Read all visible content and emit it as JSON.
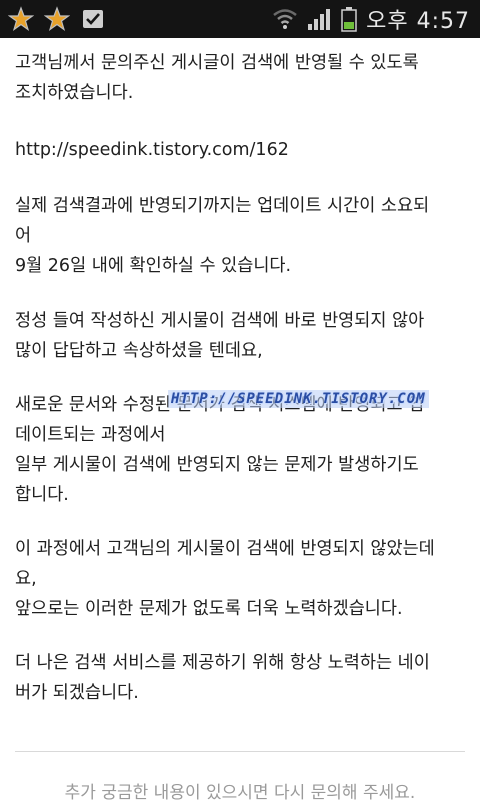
{
  "status_bar": {
    "icons_left": [
      "star-icon",
      "star-icon",
      "checkbox-icon"
    ],
    "icons_right": [
      "wifi-icon",
      "signal-icon",
      "battery-icon"
    ],
    "time": "오후 4:57",
    "colors": {
      "background": "#141414",
      "star": "#e8a22b",
      "icon": "#cfcfcf"
    }
  },
  "message": {
    "p1": [
      "고객님께서 문의주신 게시글이 검색에 반영될 수 있도록",
      "조치하였습니다."
    ],
    "url": "http://speedink.tistory.com/162",
    "p3": [
      "실제 검색결과에 반영되기까지는 업데이트 시간이 소요되",
      "어",
      "9월 26일 내에 확인하실 수 있습니다."
    ],
    "p4": [
      "정성 들여 작성하신 게시물이 검색에 바로 반영되지 않아",
      "많이 답답하고 속상하셨을 텐데요,"
    ],
    "p5": [
      "새로운 문서와 수정된 문서가 검색 시스템에 반영되고 업",
      "데이트되는 과정에서",
      "일부 게시물이 검색에 반영되지 않는 문제가 발생하기도",
      "합니다."
    ],
    "p6": [
      "이 과정에서 고객님의 게시물이 검색에 반영되지 않았는데",
      "요,",
      "앞으로는 이러한 문제가 없도록 더욱 노력하겠습니다."
    ],
    "p7": [
      "더 나은 검색 서비스를 제공하기 위해 항상 노력하는 네이",
      "버가 되겠습니다."
    ]
  },
  "watermark": "HTTP://SPEEDINK.TISTORY.COM",
  "footer": "추가 궁금한 내용이 있으시면 다시 문의해 주세요."
}
